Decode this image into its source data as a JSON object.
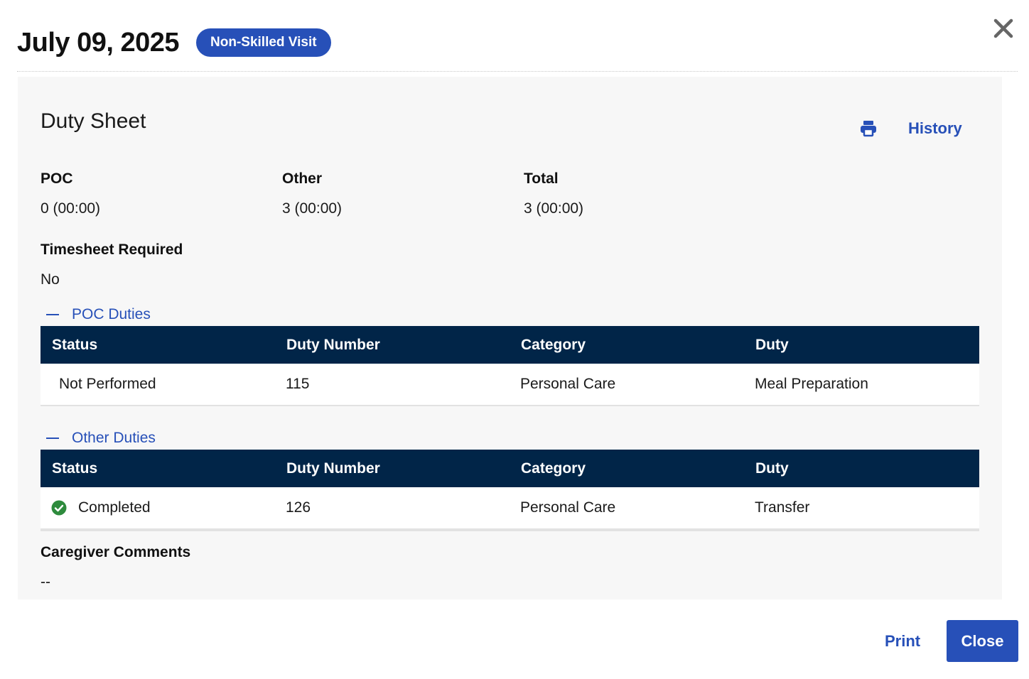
{
  "header": {
    "date": "July 09, 2025",
    "badge": "Non-Skilled Visit"
  },
  "icons": {
    "close": "close-icon",
    "print": "printer-icon",
    "completed": "check-circle-icon"
  },
  "colors": {
    "accent": "#2750b8",
    "table_header": "#012548",
    "completed": "#2e8b3d",
    "panel": "#f7f7f7"
  },
  "sheet": {
    "title": "Duty Sheet",
    "history_label": "History",
    "stats": [
      {
        "label": "POC",
        "value": "0 (00:00)"
      },
      {
        "label": "Other",
        "value": "3 (00:00)"
      },
      {
        "label": "Total",
        "value": "3 (00:00)"
      }
    ],
    "timesheet": {
      "label": "Timesheet Required",
      "value": "No"
    },
    "comments": {
      "label": "Caregiver Comments",
      "value": "--"
    }
  },
  "tables": {
    "columns": [
      "Status",
      "Duty Number",
      "Category",
      "Duty"
    ],
    "poc": {
      "title": "POC Duties",
      "rows": [
        {
          "status": "Not Performed",
          "number": "115",
          "category": "Personal Care",
          "duty": "Meal Preparation"
        }
      ]
    },
    "other": {
      "title": "Other Duties",
      "rows": [
        {
          "status": "Completed",
          "number": "126",
          "category": "Personal Care",
          "duty": "Transfer"
        }
      ]
    }
  },
  "footer": {
    "print_label": "Print",
    "close_label": "Close"
  }
}
